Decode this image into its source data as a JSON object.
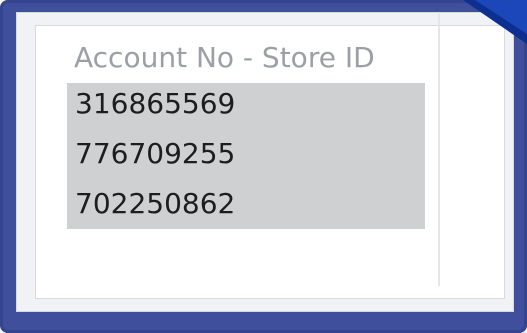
{
  "list": {
    "header": "Account No - Store ID",
    "rows": [
      "316865569",
      "776709255",
      "702250862"
    ],
    "selection_color": "#cfd0d2"
  },
  "colors": {
    "frame": "#3f4f9c",
    "header_text": "#9aa0a6",
    "row_text": "#1d1d1d"
  },
  "icons": {
    "corner": "pointer-arrow-icon"
  }
}
